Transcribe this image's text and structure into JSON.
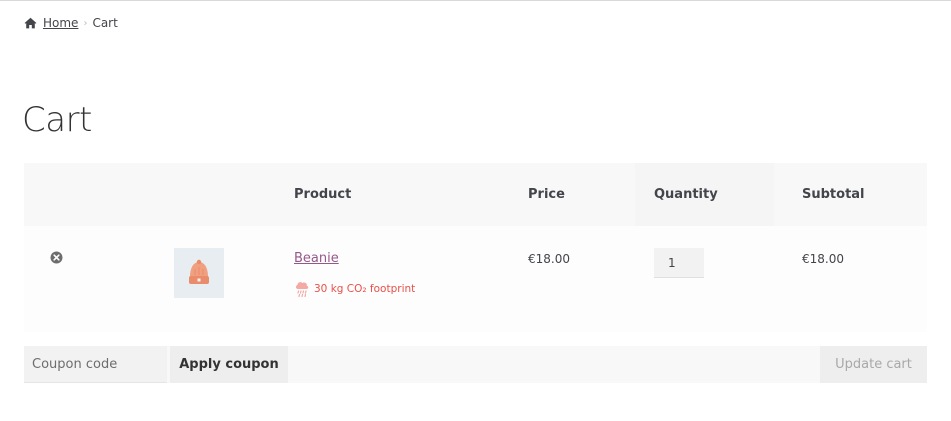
{
  "breadcrumb": {
    "home_icon": "home-icon",
    "home_label": "Home",
    "separator": "›",
    "current": "Cart"
  },
  "page": {
    "title": "Cart"
  },
  "cart_table": {
    "headers": {
      "product": "Product",
      "price": "Price",
      "quantity": "Quantity",
      "subtotal": "Subtotal"
    },
    "items": [
      {
        "remove_icon": "remove-circle-icon",
        "thumbnail_icon": "beanie-icon",
        "name": "Beanie",
        "footprint": "30 kg CO₂ footprint",
        "footprint_icon": "rain-cloud-icon",
        "price": "€18.00",
        "quantity": "1",
        "subtotal": "€18.00"
      }
    ]
  },
  "actions": {
    "coupon_placeholder": "Coupon code",
    "apply_label": "Apply coupon",
    "update_label": "Update cart"
  },
  "colors": {
    "link": "#96588a",
    "footprint": "#e9504a",
    "table_header_bg": "#f8f8f8",
    "text": "#43454b"
  }
}
